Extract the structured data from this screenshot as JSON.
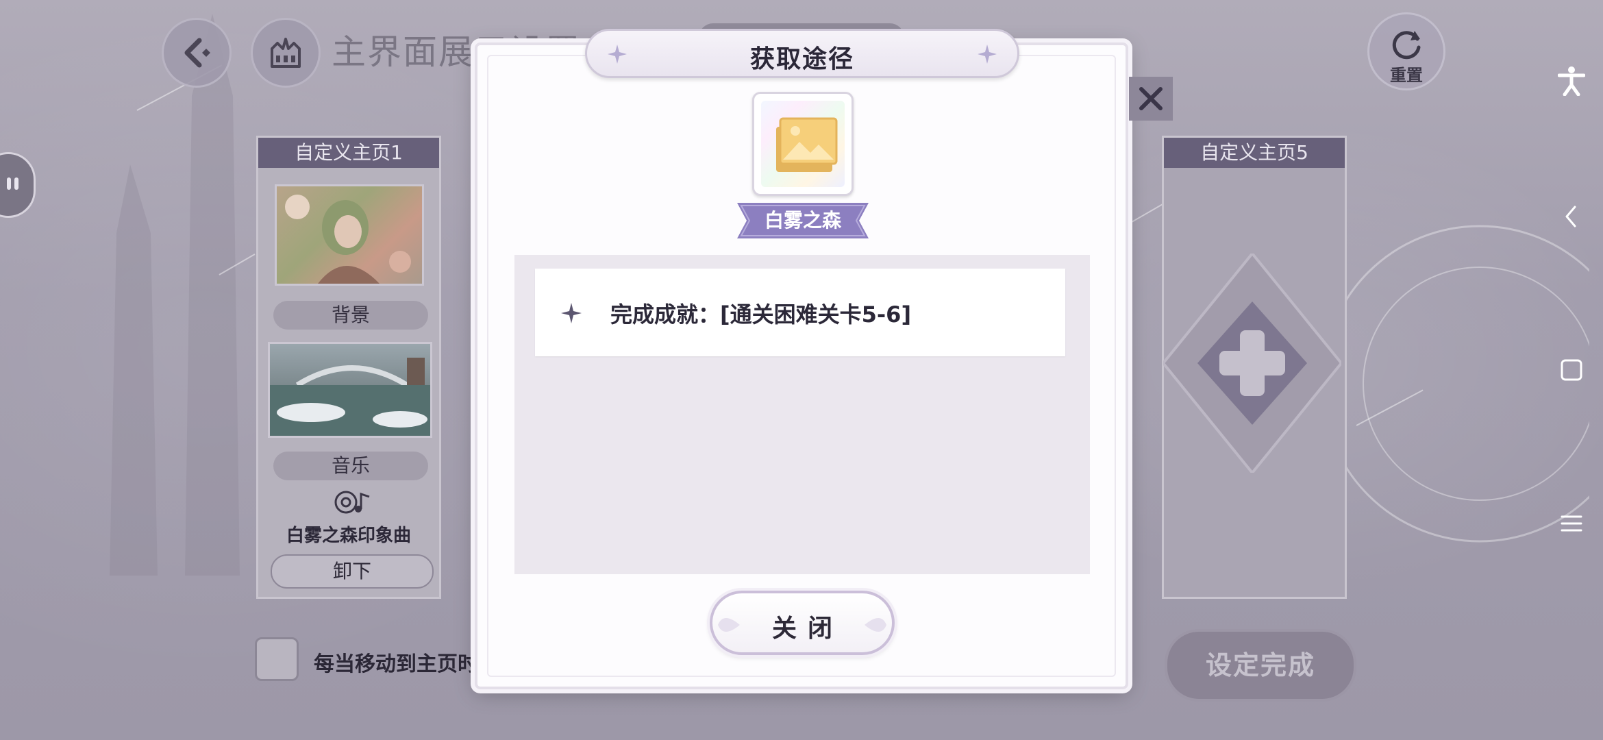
{
  "header": {
    "title": "主界面展示设置",
    "reset_label": "重置"
  },
  "left_card": {
    "title": "自定义主页1",
    "background_label": "背景",
    "music_label": "音乐",
    "music_name": "白雾之森印象曲",
    "unload_label": "卸下"
  },
  "right_card": {
    "title": "自定义主页5"
  },
  "checkbox_label": "每当移动到主页时",
  "done_label": "设定完成",
  "dialog": {
    "title": "获取途径",
    "item_name": "白雾之森",
    "routes": [
      "完成成就：[通关困难关卡5-6]"
    ],
    "close_label": "关闭"
  },
  "colors": {
    "accent_purple": "#8c7fc0",
    "dialog_bg": "#fdfcfe",
    "panel_bg": "#ebe7ee"
  },
  "icons": {
    "back": "back-arrow-icon",
    "home": "castle-home-icon",
    "reset": "refresh-icon",
    "close": "close-x-icon",
    "item": "image-frame-icon",
    "route_bullet": "four-point-star-icon",
    "add": "plus-icon",
    "music": "music-note-icon",
    "nav_accessibility": "accessibility-icon",
    "nav_back": "chevron-left-icon",
    "nav_home": "square-icon",
    "nav_menu": "menu-icon"
  }
}
